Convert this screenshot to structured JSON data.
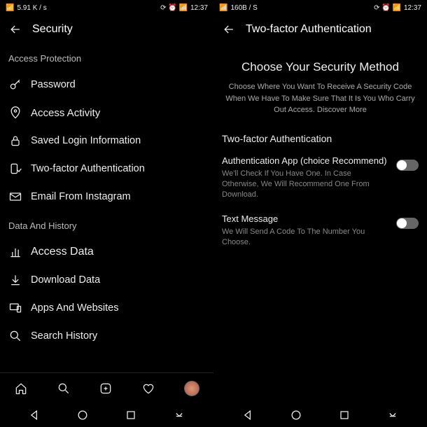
{
  "statusbar": {
    "signal_left": "5.91 K / s",
    "time": "12:37",
    "signal_right": "160B / S"
  },
  "left": {
    "title": "Security",
    "section1": "Access Protection",
    "items1": [
      {
        "label": "Password"
      },
      {
        "label": "Access Activity"
      },
      {
        "label": "Saved Login Information"
      },
      {
        "label": "Two-factor Authentication"
      },
      {
        "label": "Email From Instagram"
      }
    ],
    "section2": "Data And History",
    "items2": [
      {
        "label": "Access Data"
      },
      {
        "label": "Download Data"
      },
      {
        "label": "Apps And Websites"
      },
      {
        "label": "Search History"
      }
    ]
  },
  "right": {
    "title": "Two-factor Authentication",
    "big_title": "Choose Your Security Method",
    "desc": "Choose Where You Want To Receive A Security Code When We Have To Make Sure That It Is You Who Carry Out Access. Discover More",
    "sub_title": "Two-factor Authentication",
    "options": [
      {
        "title": "Authentication App (choice Recommend)",
        "desc": "We'll Check If You Have One. In Case Otherwise, We Will Recommend One From Download."
      },
      {
        "title": "Text Message",
        "desc": "We Will Send A Code To The Number You Choose."
      }
    ]
  }
}
